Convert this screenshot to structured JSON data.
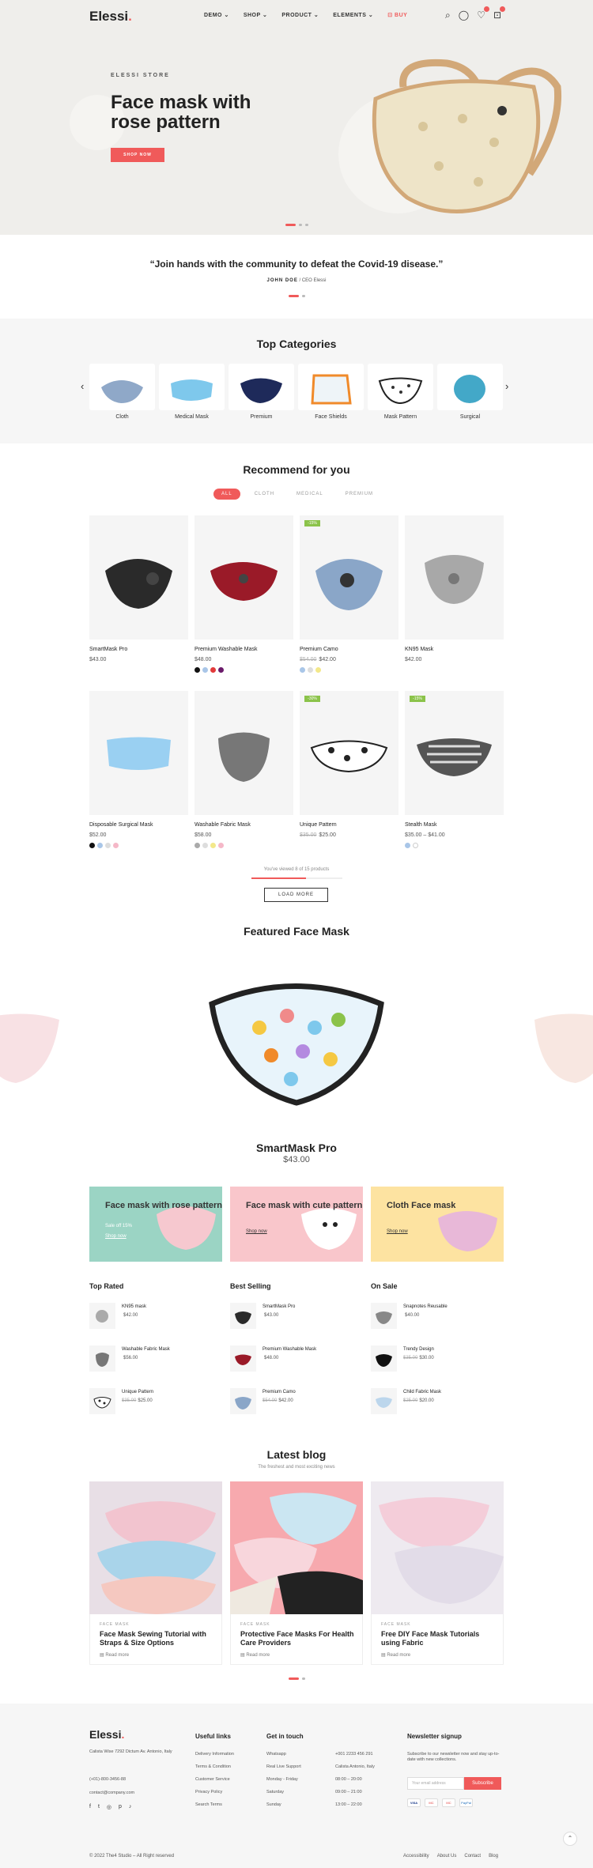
{
  "header": {
    "logo": "Elessi",
    "logo_dot": ".",
    "nav": [
      "DEMO ⌄",
      "SHOP ⌄",
      "PRODUCT ⌄",
      "ELEMENTS ⌄",
      "BUY"
    ]
  },
  "hero": {
    "eyebrow": "ELESSI STORE",
    "title": "Face mask with rose pattern",
    "cta": "SHOP NOW"
  },
  "quote": {
    "text": "“Join hands with the community to defeat the Covid-19 disease.”",
    "author": "JOHN DOE",
    "role": " / CEO Elessi"
  },
  "categories": {
    "title": "Top Categories",
    "items": [
      "Cloth",
      "Medical Mask",
      "Premium",
      "Face Shields",
      "Mask Pattern",
      "Surgical"
    ]
  },
  "recommend": {
    "title": "Recommend for you",
    "tabs": [
      "ALL",
      "CLOTH",
      "MEDICAL",
      "PREMIUM"
    ]
  },
  "products": [
    {
      "name": "SmartMask Pro",
      "old": "",
      "price": "$43.00",
      "sale": ""
    },
    {
      "name": "Premium Washable Mask",
      "old": "",
      "price": "$48.00",
      "sale": ""
    },
    {
      "name": "Premium Camo",
      "old": "$54.00",
      "price": "$42.00",
      "sale": "-15%"
    },
    {
      "name": "KN95 Mask",
      "old": "",
      "price": "$42.00",
      "sale": ""
    },
    {
      "name": "Disposable Surgical Mask",
      "old": "",
      "price": "$52.00",
      "sale": ""
    },
    {
      "name": "Washable Fabric Mask",
      "old": "",
      "price": "$58.00",
      "sale": ""
    },
    {
      "name": "Unique Pattern",
      "old": "$35.00",
      "price": "$25.00",
      "sale": "-30%"
    },
    {
      "name": "Stealth Mask",
      "old": "",
      "price": "$35.00 – $41.00",
      "sale": "-15%"
    }
  ],
  "viewed_text": "You've viewed 8 of 15 products",
  "load_more": "LOAD MORE",
  "featured": {
    "title": "Featured Face Mask",
    "name": "SmartMask Pro",
    "price": "$43.00"
  },
  "banners": [
    {
      "title": "Face mask with rose pattern",
      "sub": "Sale off 15%",
      "link": "Shop now"
    },
    {
      "title": "Face mask with cute pattern",
      "sub": "",
      "link": "Shop now"
    },
    {
      "title": "Cloth Face mask",
      "sub": "",
      "link": "Shop now"
    }
  ],
  "lists": [
    {
      "title": "Top Rated",
      "items": [
        {
          "name": "KN95 mask",
          "old": "",
          "price": "$42.00"
        },
        {
          "name": "Washable Fabric Mask",
          "old": "",
          "price": "$56.00"
        },
        {
          "name": "Unique Pattern",
          "old": "$35.00",
          "price": "$25.00"
        }
      ]
    },
    {
      "title": "Best Selling",
      "items": [
        {
          "name": "SmartMask Pro",
          "old": "",
          "price": "$43.00"
        },
        {
          "name": "Premium Washable Mask",
          "old": "",
          "price": "$48.00"
        },
        {
          "name": "Premium Camo",
          "old": "$54.00",
          "price": "$42.00"
        }
      ]
    },
    {
      "title": "On Sale",
      "items": [
        {
          "name": "Snapnotes Reusable",
          "old": "",
          "price": "$40.00"
        },
        {
          "name": "Trendy Design",
          "old": "$35.00",
          "price": "$30.00"
        },
        {
          "name": "Child Fabric Mask",
          "old": "$25.00",
          "price": "$20.00"
        }
      ]
    }
  ],
  "blog": {
    "title": "Latest blog",
    "subtitle": "The freshest and most exciting news",
    "posts": [
      {
        "tag": "FACE MASK",
        "title": "Face Mask Sewing Tutorial with Straps & Size Options",
        "read": "Read more"
      },
      {
        "tag": "FACE MASK",
        "title": "Protective Face Masks For Health Care Providers",
        "read": "Read more"
      },
      {
        "tag": "FACE MASK",
        "title": "Free DIY Face Mask Tutorials using Fabric",
        "read": "Read more"
      }
    ]
  },
  "footer": {
    "logo": "Elessi",
    "address": "Calista Wise 7292 Dictum Av. Antonio, Italy",
    "phone": "(+01)-800-3456-88",
    "email": "contact@company.com",
    "useful_title": "Useful links",
    "useful": [
      "Delivery Information",
      "Terms & Condition",
      "Customer Service",
      "Privacy Policy",
      "Search Terms"
    ],
    "touch_title": "Get in touch",
    "touch": [
      {
        "k": "Whatsapp",
        "v": "+001 2233 456 291"
      },
      {
        "k": "Real Live Support",
        "v": "Calista Antonio, Italy"
      },
      {
        "k": "Monday - Friday",
        "v": "08:00 – 20:00"
      },
      {
        "k": "Saturday",
        "v": "09:00 – 21:00"
      },
      {
        "k": "Sunday",
        "v": "13:00 – 22:00"
      }
    ],
    "news_title": "Newsletter signup",
    "news_text": "Subscribe to our newsletter now and stay up-to-date with new collections.",
    "news_placeholder": "Your email address",
    "news_button": "Subscribe",
    "payments": [
      "VISA",
      "MC",
      "MC",
      "PayPal"
    ],
    "copyright": "© 2022 The4 Studio – All Right reserved",
    "bottom_links": [
      "Accessibility",
      "About Us",
      "Contact",
      "Blog"
    ]
  },
  "colors": {
    "accent": "#f05a5a",
    "teal": "#9bd4c4",
    "pink": "#f9c6cb",
    "yellow": "#fde3a1",
    "sale": "#8bc34a"
  }
}
